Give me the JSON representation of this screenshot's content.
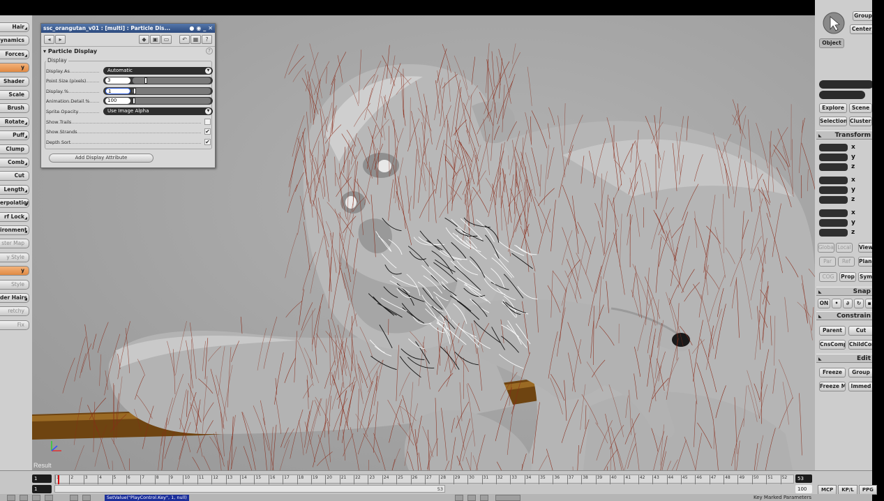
{
  "left_toolbar": {
    "items": [
      {
        "label": "Hair",
        "style": "normal",
        "menu": true
      },
      {
        "label": "ynamics",
        "style": "normal",
        "menu": false
      },
      {
        "label": "Forces",
        "style": "normal",
        "menu": true
      },
      {
        "label": "y",
        "style": "orange",
        "menu": false
      },
      {
        "label": "Shader",
        "style": "normal",
        "menu": false
      },
      {
        "label": "Scale",
        "style": "normal",
        "menu": false
      },
      {
        "label": "Brush",
        "style": "normal",
        "menu": false
      },
      {
        "label": "Rotate",
        "style": "normal",
        "menu": true
      },
      {
        "label": "Puff",
        "style": "normal",
        "menu": true
      },
      {
        "label": "Clump",
        "style": "normal",
        "menu": false
      },
      {
        "label": "Comb",
        "style": "normal",
        "menu": true
      },
      {
        "label": "Cut",
        "style": "normal",
        "menu": false
      },
      {
        "label": "Length",
        "style": "normal",
        "menu": true
      },
      {
        "label": "erpolation",
        "style": "normal",
        "menu": true
      },
      {
        "label": "rf Lock",
        "style": "normal",
        "menu": true
      },
      {
        "label": "ironment",
        "style": "normal",
        "menu": true
      },
      {
        "label": "ster Map",
        "style": "grey",
        "menu": false
      },
      {
        "label": "y Style",
        "style": "grey",
        "menu": false
      },
      {
        "label": "y",
        "style": "orange",
        "menu": false
      },
      {
        "label": "Style",
        "style": "grey",
        "menu": false
      },
      {
        "label": "der Hairs",
        "style": "normal",
        "menu": true
      },
      {
        "label": "retchy",
        "style": "grey",
        "menu": false
      },
      {
        "label": "Fix",
        "style": "grey",
        "menu": false
      }
    ]
  },
  "viewport": {
    "result_label": "Result",
    "colors": {
      "background": "#a8a8a8",
      "hair": "#8a2a18",
      "branch": "#7a4a12",
      "skin": "#b9b9b9"
    }
  },
  "particle_panel": {
    "title": "ssc_orangutan_v01 : [multi] : Particle Dis...",
    "section": "Particle Display",
    "help": "?",
    "group": "Display",
    "display_as": {
      "label": "Display As",
      "value": "Automatic"
    },
    "point_size": {
      "label": "Point Size (pixels)",
      "value": "3",
      "fraction": 0.15
    },
    "display_pct": {
      "label": "Display %",
      "value": "1",
      "fraction": 0.01
    },
    "animation_detail": {
      "label": "Animation Detail %",
      "value": "100",
      "fraction": 0.0
    },
    "sprite_opacity": {
      "label": "Sprite Opacity",
      "value": "Use Image Alpha"
    },
    "checks": [
      {
        "label": "Show Trails",
        "checked": false
      },
      {
        "label": "Show Strands",
        "checked": true
      },
      {
        "label": "Depth Sort",
        "checked": true
      }
    ],
    "add_button": "Add Display Attribute"
  },
  "right_panel": {
    "top_buttons": [
      "Group",
      "Center"
    ],
    "object_button": "Object",
    "explore_buttons": [
      "Explore",
      "Scene"
    ],
    "selection_buttons": [
      "Selection",
      "Clusters"
    ],
    "transform_header": "Transform",
    "axes": [
      "x",
      "y",
      "z",
      "x",
      "y",
      "z",
      "x",
      "y",
      "z"
    ],
    "space_buttons": [
      "Global",
      "Local",
      "View"
    ],
    "ref_buttons": [
      "Par",
      "Ref",
      "Plane"
    ],
    "cog_buttons": [
      "COG",
      "Prop",
      "Sym"
    ],
    "snap_header": "Snap",
    "snap_on": "ON",
    "constrain_header": "Constrain",
    "constrain_buttons": [
      "Parent",
      "Cut",
      "CnsComp",
      "ChildComp"
    ],
    "edit_header": "Edit",
    "edit_buttons": [
      "Freeze",
      "Group",
      "Freeze M",
      "Immed"
    ]
  },
  "timeline": {
    "start_frame": "1",
    "end_field": "53",
    "end_total": "100",
    "range_start": "1",
    "range_end": "53",
    "tick_labels": [
      "1",
      "2",
      "3",
      "4",
      "5",
      "6",
      "7",
      "8",
      "9",
      "10",
      "11",
      "12",
      "13",
      "14",
      "15",
      "16",
      "17",
      "18",
      "19",
      "20",
      "21",
      "22",
      "23",
      "24",
      "25",
      "26",
      "27",
      "28",
      "29",
      "30",
      "31",
      "32",
      "33",
      "34",
      "35",
      "36",
      "37",
      "38",
      "39",
      "40",
      "41",
      "42",
      "43",
      "44",
      "45",
      "46",
      "47",
      "48",
      "49",
      "50",
      "51",
      "52"
    ],
    "tabs": [
      "MCP",
      "KP/L",
      "PPG"
    ],
    "script_line": "SetValue(\"PlayControl.Key\", 1, null)",
    "key_marked": "Key Marked Parameters"
  }
}
